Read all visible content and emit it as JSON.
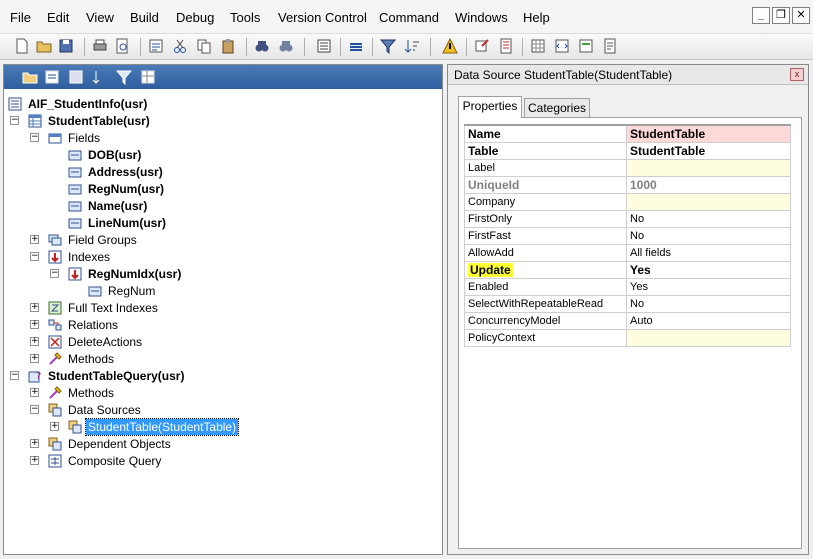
{
  "menu": [
    "File",
    "Edit",
    "View",
    "Build",
    "Debug",
    "Tools",
    "Version Control",
    "Command",
    "Windows",
    "Help"
  ],
  "window_controls": {
    "minimize": "_",
    "restore": "❐",
    "close": "✕"
  },
  "toolbar_icons": [
    "new-icon",
    "open-icon",
    "save-icon",
    "print-icon",
    "print-preview-icon",
    "properties-icon",
    "cut-icon",
    "copy-icon",
    "paste-icon",
    "find-icon",
    "find-next-icon",
    "compile-icon",
    "layers-icon",
    "filter-icon",
    "sort-icon",
    "warning-icon",
    "import-icon",
    "list-icon",
    "grid-icon",
    "code-icon",
    "form-icon",
    "report-icon"
  ],
  "left_toolbar_icons": [
    "open-folder-icon",
    "properties-icon",
    "compile-icon",
    "sort-icon",
    "filter-icon",
    "grid-icon"
  ],
  "tree": [
    {
      "label": "AIF_StudentInfo(usr)",
      "bold": true,
      "icon": "project-icon"
    },
    {
      "label": "StudentTable(usr)",
      "bold": true,
      "icon": "table-icon",
      "expander": "−"
    },
    {
      "label": "Fields",
      "bold": false,
      "icon": "fields-icon",
      "expander": "−"
    },
    {
      "label": "DOB(usr)",
      "bold": true,
      "icon": "field-icon"
    },
    {
      "label": "Address(usr)",
      "bold": true,
      "icon": "field-icon"
    },
    {
      "label": "RegNum(usr)",
      "bold": true,
      "icon": "field-icon"
    },
    {
      "label": "Name(usr)",
      "bold": true,
      "icon": "field-icon"
    },
    {
      "label": "LineNum(usr)",
      "bold": true,
      "icon": "field-icon"
    },
    {
      "label": "Field Groups",
      "bold": false,
      "icon": "field-groups-icon",
      "expander": "+"
    },
    {
      "label": "Indexes",
      "bold": false,
      "icon": "indexes-icon",
      "expander": "−"
    },
    {
      "label": "RegNumIdx(usr)",
      "bold": true,
      "icon": "index-icon",
      "expander": "−"
    },
    {
      "label": "RegNum",
      "bold": false,
      "icon": "field-icon"
    },
    {
      "label": "Full Text Indexes",
      "bold": false,
      "icon": "full-text-index-icon",
      "expander": "+"
    },
    {
      "label": "Relations",
      "bold": false,
      "icon": "relations-icon",
      "expander": "+"
    },
    {
      "label": "DeleteActions",
      "bold": false,
      "icon": "delete-actions-icon",
      "expander": "+"
    },
    {
      "label": "Methods",
      "bold": false,
      "icon": "methods-icon",
      "expander": "+"
    },
    {
      "label": "StudentTableQuery(usr)",
      "bold": true,
      "icon": "query-icon",
      "expander": "−"
    },
    {
      "label": "Methods",
      "bold": false,
      "icon": "methods-icon",
      "expander": "+"
    },
    {
      "label": "Data Sources",
      "bold": false,
      "icon": "data-sources-icon",
      "expander": "−"
    },
    {
      "label": "StudentTable(StudentTable)",
      "bold": false,
      "icon": "data-source-icon",
      "expander": "+",
      "selected": true
    },
    {
      "label": "Dependent Objects",
      "bold": false,
      "icon": "dependent-objects-icon",
      "expander": "+"
    },
    {
      "label": "Composite Query",
      "bold": false,
      "icon": "composite-query-icon",
      "expander": "+"
    }
  ],
  "properties_window": {
    "title": "Data Source StudentTable(StudentTable)",
    "close": "x",
    "tabs": [
      "Properties",
      "Categories"
    ],
    "rows": [
      {
        "name": "Name",
        "value": "StudentTable"
      },
      {
        "name": "Table",
        "value": "StudentTable"
      },
      {
        "name": "Label",
        "value": ""
      },
      {
        "name": "UniqueId",
        "value": "1000"
      },
      {
        "name": "Company",
        "value": ""
      },
      {
        "name": "FirstOnly",
        "value": "No"
      },
      {
        "name": "FirstFast",
        "value": "No"
      },
      {
        "name": "AllowAdd",
        "value": "All fields"
      },
      {
        "name": "Update",
        "value": "Yes"
      },
      {
        "name": "Enabled",
        "value": "Yes"
      },
      {
        "name": "SelectWithRepeatableRead",
        "value": "No"
      },
      {
        "name": "ConcurrencyModel",
        "value": "Auto"
      },
      {
        "name": "PolicyContext",
        "value": ""
      }
    ]
  }
}
